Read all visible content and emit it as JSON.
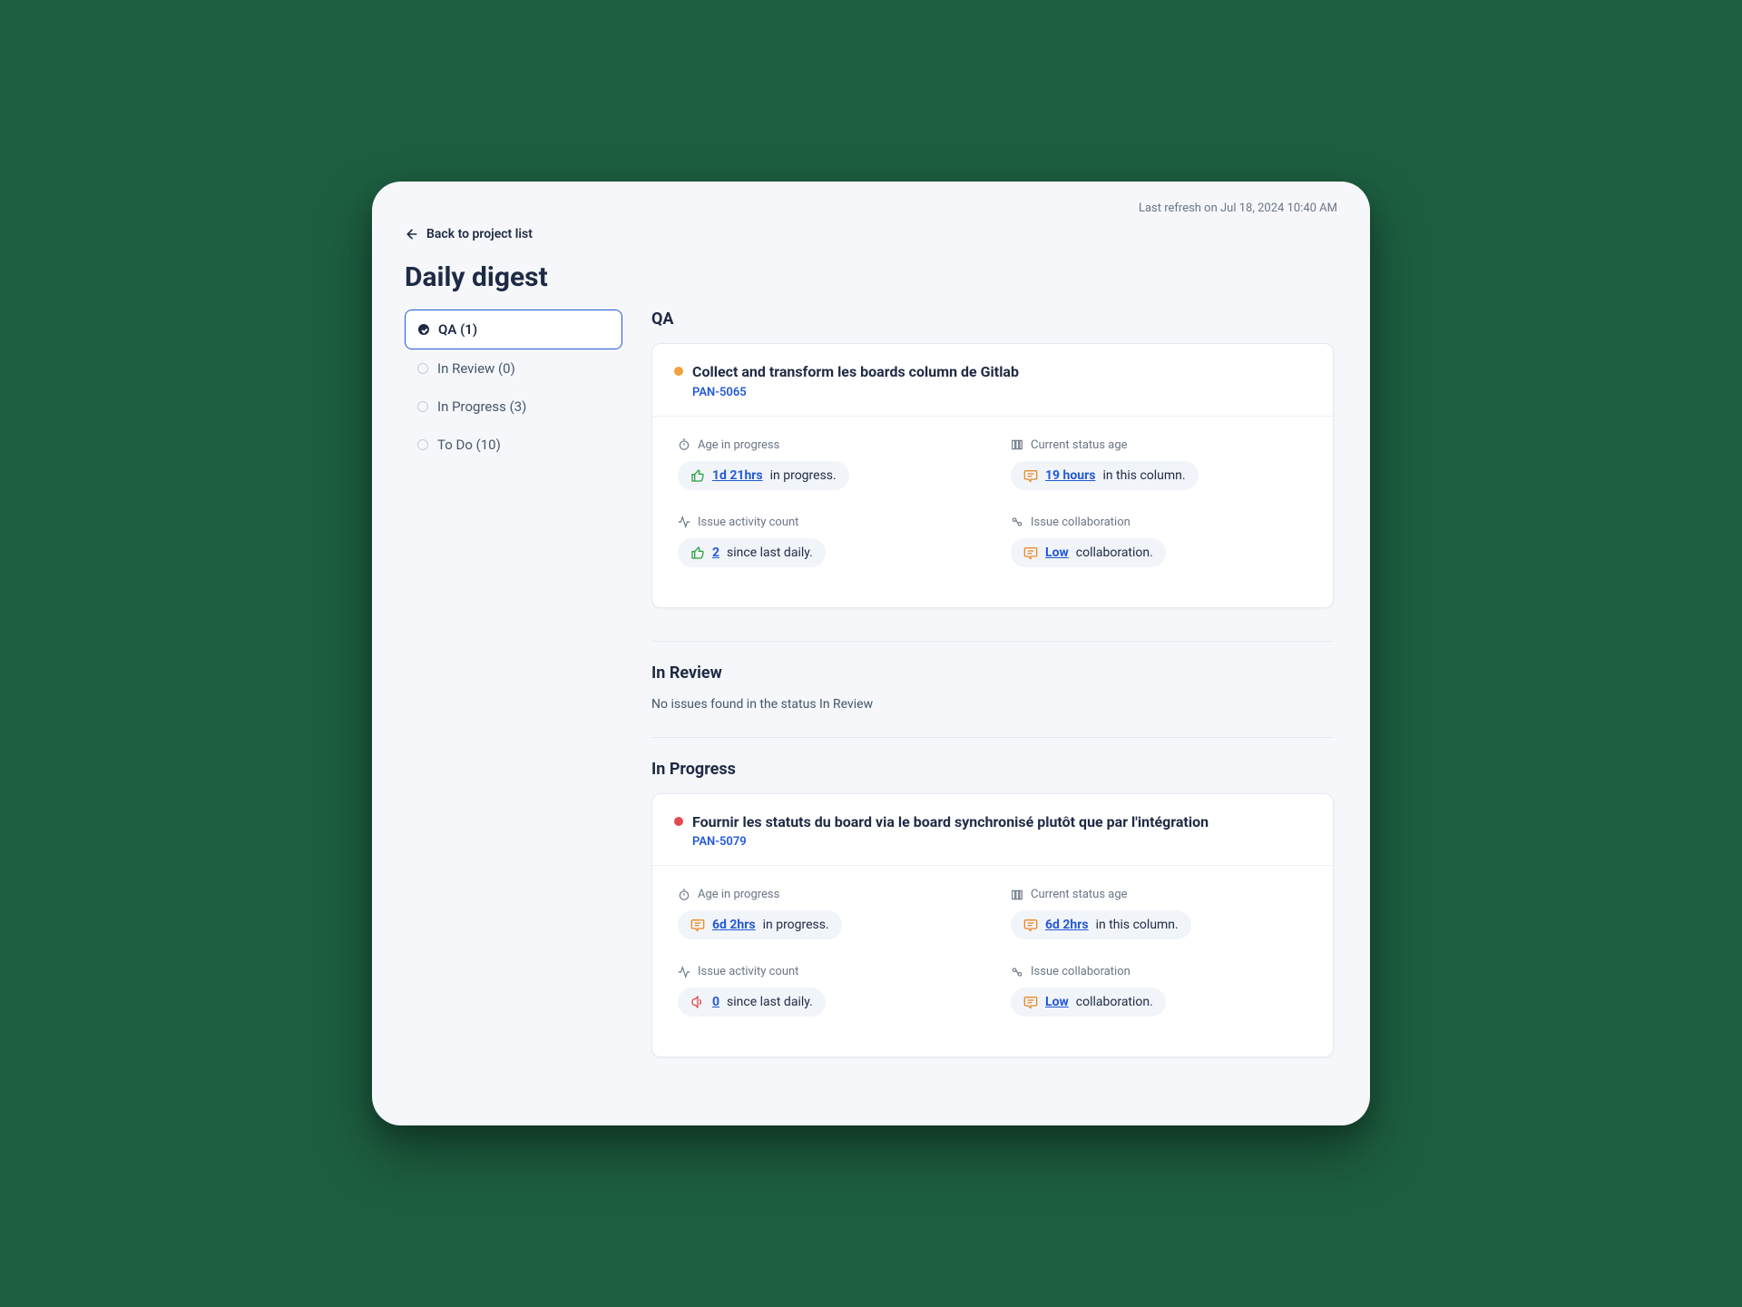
{
  "header": {
    "last_refresh": "Last refresh on Jul 18, 2024 10:40 AM",
    "back_label": "Back to project list",
    "page_title": "Daily digest"
  },
  "sidebar": {
    "items": [
      {
        "label": "QA (1)",
        "active": true
      },
      {
        "label": "In Review (0)",
        "active": false
      },
      {
        "label": "In Progress (3)",
        "active": false
      },
      {
        "label": "To Do (10)",
        "active": false
      }
    ]
  },
  "main": {
    "sections": [
      {
        "title": "QA",
        "issues": [
          {
            "status_color": "orange",
            "title": "Collect and transform les boards column de Gitlab",
            "key": "PAN-5065",
            "metrics": {
              "age_in_progress": {
                "label": "Age in progress",
                "value": "1d 21hrs",
                "suffix": " in progress.",
                "tone": "green"
              },
              "current_status_age": {
                "label": "Current status age",
                "value": "19 hours",
                "suffix": " in this column.",
                "tone": "orange"
              },
              "activity_count": {
                "label": "Issue activity count",
                "value": "2",
                "suffix": " since last daily.",
                "tone": "green"
              },
              "collaboration": {
                "label": "Issue collaboration",
                "value": "Low",
                "suffix": " collaboration.",
                "tone": "orange"
              }
            }
          }
        ]
      },
      {
        "title": "In Review",
        "empty": "No issues found in the status In Review"
      },
      {
        "title": "In Progress",
        "issues": [
          {
            "status_color": "red",
            "title": "Fournir les statuts du board via le board synchronisé plutôt que par l'intégration",
            "key": "PAN-5079",
            "metrics": {
              "age_in_progress": {
                "label": "Age in progress",
                "value": "6d 2hrs",
                "suffix": " in progress.",
                "tone": "orange"
              },
              "current_status_age": {
                "label": "Current status age",
                "value": "6d 2hrs",
                "suffix": " in this column.",
                "tone": "orange"
              },
              "activity_count": {
                "label": "Issue activity count",
                "value": "0",
                "suffix": " since last daily.",
                "tone": "red"
              },
              "collaboration": {
                "label": "Issue collaboration",
                "value": "Low",
                "suffix": " collaboration.",
                "tone": "orange"
              }
            }
          }
        ]
      }
    ]
  }
}
